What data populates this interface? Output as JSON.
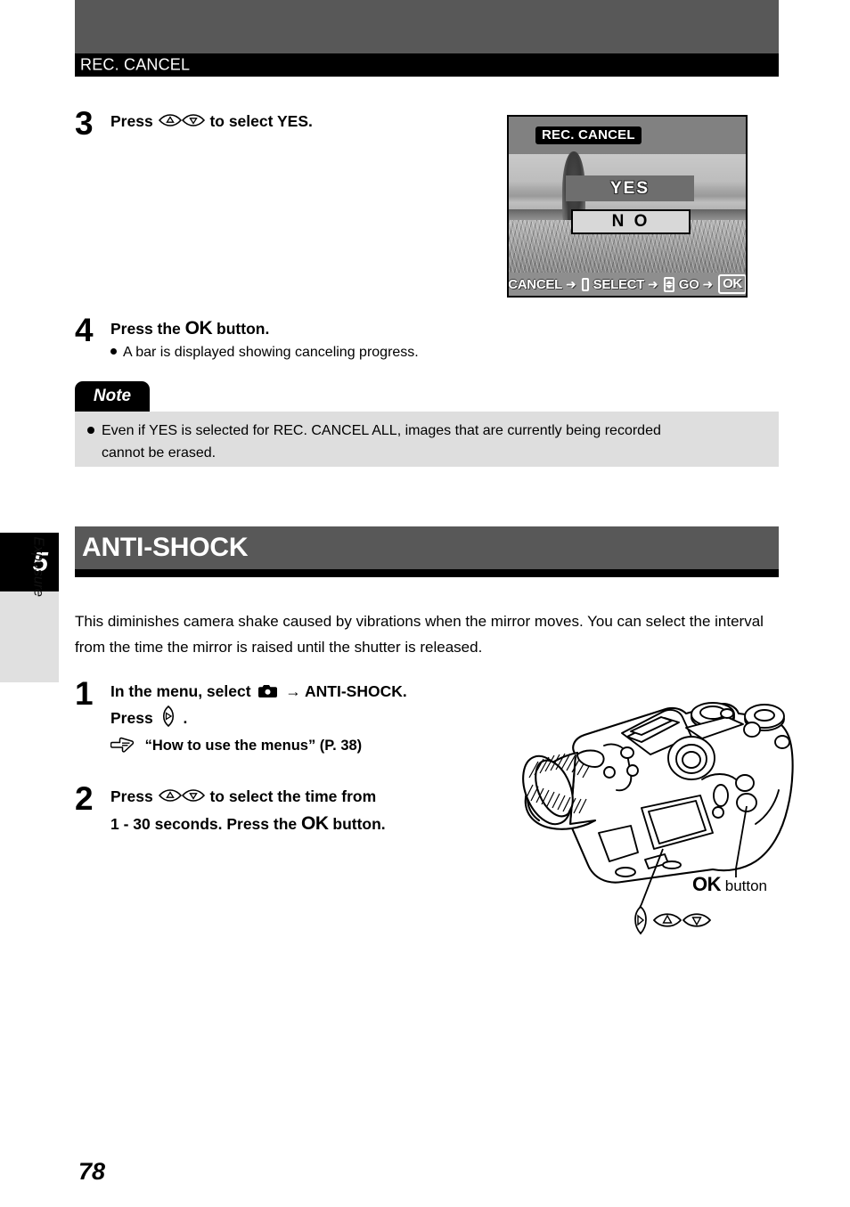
{
  "page": {
    "running_header": "REC. CANCEL",
    "page_number": "78"
  },
  "chapter_tab": {
    "number": "5",
    "name": "Exposure"
  },
  "steps_top": [
    {
      "number": "3",
      "line1_before": "Press",
      "line1_after": "to select YES.",
      "icon": "up-down-arrow-pad-icon"
    },
    {
      "number": "4",
      "line1_before": "Press the",
      "line1_ok": "OK",
      "line1_after": "button.",
      "bullet": "A bar is displayed showing canceling progress."
    }
  ],
  "lcd_screen": {
    "title": "REC. CANCEL",
    "option_selected": "YES",
    "option_other": "N O",
    "footer": {
      "cancel_label": "CANCEL",
      "cancel_arrow": "➜",
      "cancel_icon": "menu-list-icon",
      "select_label": "SELECT",
      "select_arrow": "➜",
      "select_icon": "up-down-arrow-icon",
      "go_label": "GO",
      "go_arrow": "➜",
      "go_button": "OK"
    }
  },
  "note": {
    "tab_label": "Note",
    "line1": "Even if YES is selected for REC. CANCEL ALL, images that are currently being recorded",
    "line2": "cannot be erased."
  },
  "section": {
    "title": "ANTI-SHOCK",
    "intro": "This diminishes camera shake caused by vibrations when the mirror moves. You can select the interval from the time the mirror is raised until the shutter is released."
  },
  "steps_bottom": [
    {
      "number": "1",
      "line1_before": "In the menu, select",
      "line1_icon": "camera-rec-mode-icon",
      "line1_arrow": "→",
      "line1_after": "ANTI-SHOCK.",
      "line2_before": "Press",
      "line2_icon": "left-arrow-pad-icon",
      "line2_after": ".",
      "line3_icon": "pointing-hand-icon",
      "line3": "“How to use the menus” (P. 38)"
    },
    {
      "number": "2",
      "line1_before": "Press",
      "line1_icon": "up-down-arrow-pad-icon",
      "line1_after": "to select the time from",
      "line2_before": "1 - 30 seconds. Press the",
      "line2_ok": "OK",
      "line2_after": "button."
    }
  ],
  "camera_callout": {
    "ok_label": "OK",
    "button_word": "button",
    "arrow_pad_icon": "left-up-down-arrow-pad-icon"
  },
  "colors": {
    "header_gray": "#585858",
    "header_black": "#000000",
    "note_bg": "#dedede",
    "chapter_tab_gray": "#e0e0e0"
  }
}
